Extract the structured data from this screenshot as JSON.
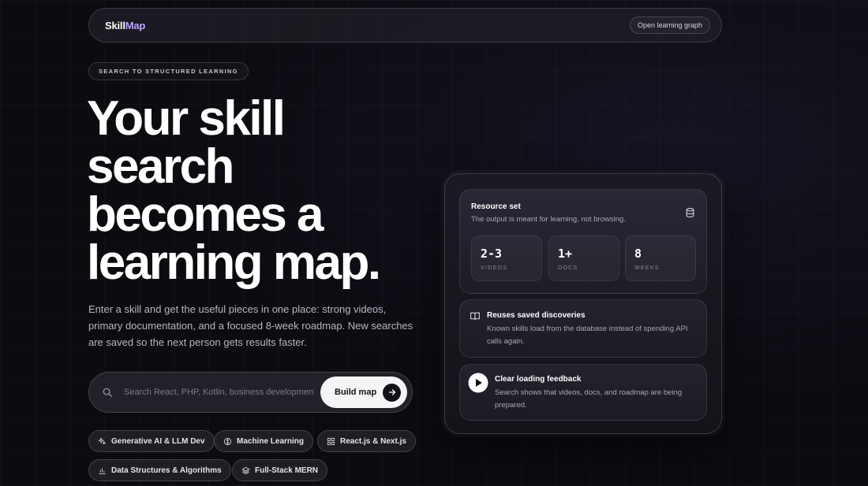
{
  "nav": {
    "logo_primary": "Skill",
    "logo_accent": "Map",
    "graph_button": "Open learning graph"
  },
  "eyebrow": "SEARCH TO STRUCTURED LEARNING",
  "hero": {
    "line1": "Your skill",
    "line2": "search",
    "line3": "becomes a",
    "line4": "learning map."
  },
  "description": "Enter a skill and get the useful pieces in one place: strong videos, primary documentation, and a focused 8-week roadmap. New searches are saved so the next person gets results faster.",
  "search": {
    "placeholder": "Search React, PHP, Kotlin, business development",
    "value": "",
    "button": "Build map"
  },
  "chips": [
    {
      "label": "Generative AI & LLM Dev",
      "icon": "sparkles-icon"
    },
    {
      "label": "Machine Learning",
      "icon": "brain-icon"
    },
    {
      "label": "React.js & Next.js",
      "icon": "grid-icon"
    },
    {
      "label": "Data Structures & Algorithms",
      "icon": "bar-chart-icon"
    },
    {
      "label": "Full-Stack MERN",
      "icon": "layers-icon"
    }
  ],
  "panel": {
    "resource": {
      "title": "Resource set",
      "subtitle": "The output is meant for learning, not browsing.",
      "icon": "database-icon",
      "stats": [
        {
          "value": "2-3",
          "label": "VIDEOS"
        },
        {
          "value": "1+",
          "label": "DOCS"
        },
        {
          "value": "8",
          "label": "WEEKS"
        }
      ]
    },
    "saved": {
      "title": "Reuses saved discoveries",
      "text": "Known skills load from the database instead of spending API calls again.",
      "icon": "book-open-icon"
    },
    "loading": {
      "title": "Clear loading feedback",
      "text": "Search shows that videos, docs, and roadmap are being prepared.",
      "icon": "play-icon"
    }
  },
  "colors": {
    "background": "#0c0b10",
    "accent": "#b9a6ff",
    "button_bg": "#f5f5f7"
  }
}
